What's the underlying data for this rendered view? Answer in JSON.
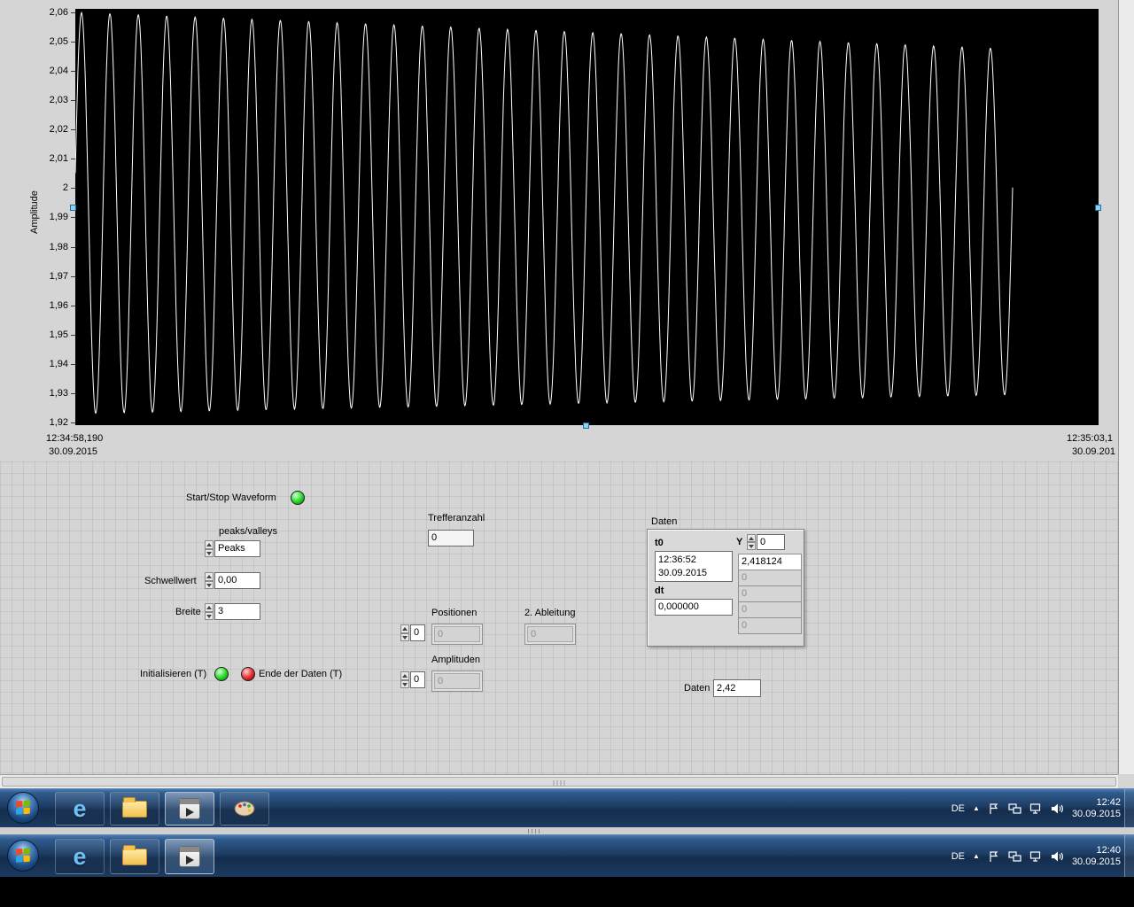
{
  "chart": {
    "ylabel": "Amplitude",
    "y_ticks": [
      "2,06",
      "2,05",
      "2,04",
      "2,03",
      "2,02",
      "2,01",
      "2",
      "1,99",
      "1,98",
      "1,97",
      "1,96",
      "1,95",
      "1,94",
      "1,93",
      "1,92"
    ],
    "x_left_time": "12:34:58,190",
    "x_left_date": "30.09.2015",
    "x_right_time": "12:35:03,1",
    "x_right_date": "30.09.201"
  },
  "chart_data": {
    "type": "line",
    "title": "",
    "ylabel": "Amplitude",
    "ylim": [
      1.92,
      2.06
    ],
    "x_range_labels": [
      "12:34:58,190 30.09.2015",
      "12:35:03,1 30.09.201"
    ],
    "grid": false,
    "plot_bg": "#000000",
    "line_color": "#ffffff",
    "series": [
      {
        "name": "Amplitude",
        "description": "sine waveform, slowly decaying envelope",
        "cycles": 33,
        "phase": 0.2,
        "mean_start": 1.9915,
        "mean_end": 1.9885,
        "amp_start": 0.0685,
        "amp_end": 0.059,
        "x_fraction": 0.916
      }
    ]
  },
  "panel": {
    "start_stop_label": "Start/Stop Waveform",
    "peaks_valleys_label": "peaks/valleys",
    "peaks_value": "Peaks",
    "schwellwert_label": "Schwellwert",
    "schwellwert_value": "0,00",
    "breite_label": "Breite",
    "breite_value": "3",
    "trefferanzahl_label": "Trefferanzahl",
    "trefferanzahl_value": "0",
    "positionen_label": "Positionen",
    "positionen_spin_value": "0",
    "positionen_value": "0",
    "ableitung_label": "2. Ableitung",
    "ableitung_value": "0",
    "amplituden_label": "Amplituden",
    "amplituden_spin_value": "0",
    "amplituden_value": "0",
    "initialisieren_label": "Initialisieren (T)",
    "ende_label": "Ende der Daten (T)",
    "daten_cluster": {
      "title": "Daten",
      "t0_label": "t0",
      "t0_time": "12:36:52",
      "t0_date": "30.09.2015",
      "dt_label": "dt",
      "dt_value": "0,000000",
      "y_label": "Y",
      "y_index": "0",
      "y_values": [
        "2,418124",
        "0",
        "0",
        "0",
        "0"
      ]
    },
    "daten_out_label": "Daten",
    "daten_out_value": "2,42"
  },
  "taskbar1": {
    "lang": "DE",
    "time": "12:42",
    "date": "30.09.2015"
  },
  "taskbar2": {
    "lang": "DE",
    "time": "12:40",
    "date": "30.09.2015"
  },
  "colors": {
    "taskbar_accent": "#1d3c63",
    "led_green": "#2ecc2e",
    "led_red": "#d42020",
    "selection_handle": "#8ed0f0"
  }
}
